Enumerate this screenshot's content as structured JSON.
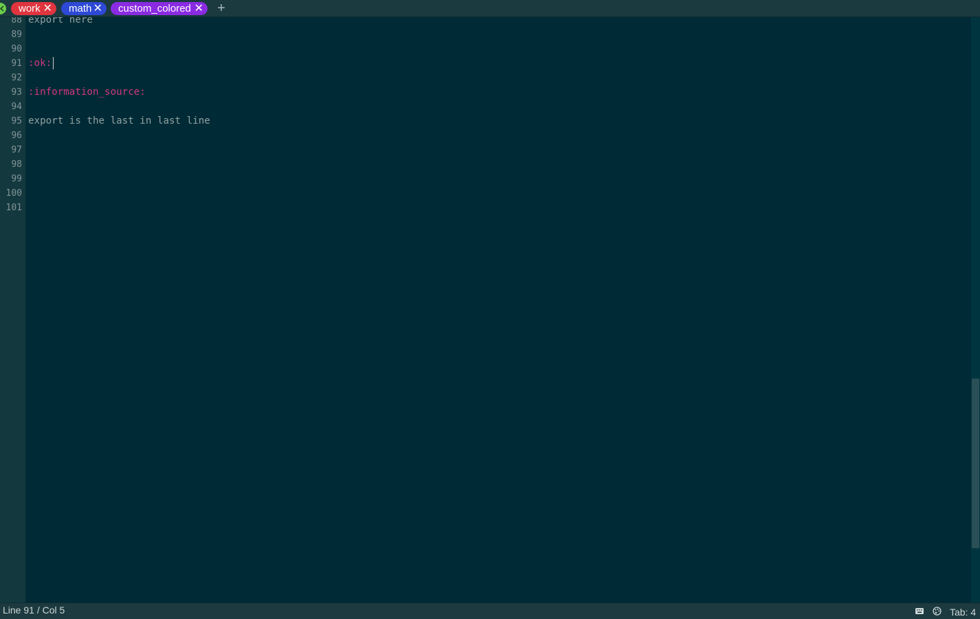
{
  "tabs": [
    {
      "label": "work",
      "color": "#e0343f"
    },
    {
      "label": "math",
      "color": "#2e49d6"
    },
    {
      "label": "custom_colored",
      "color": "#8a2be2"
    }
  ],
  "tab_close_glyph": "✕",
  "add_tab_glyph": "+",
  "editor": {
    "line_numbers": [
      "88",
      "89",
      "90",
      "91",
      "92",
      "93",
      "94",
      "95",
      "96",
      "97",
      "98",
      "99",
      "100",
      "101"
    ],
    "lines": {
      "l88": "export here",
      "l91": ":ok:",
      "l93": ":information_source:",
      "l95": "export is the last in last line"
    },
    "emoji_code_color": "#d33682",
    "text_color": "#93a1a1",
    "background": "#002b36"
  },
  "status": {
    "cursor_position": "Line 91 / Col 5",
    "tab_width": "Tab: 4",
    "icons": [
      "keyboard-icon",
      "palette-icon"
    ]
  }
}
